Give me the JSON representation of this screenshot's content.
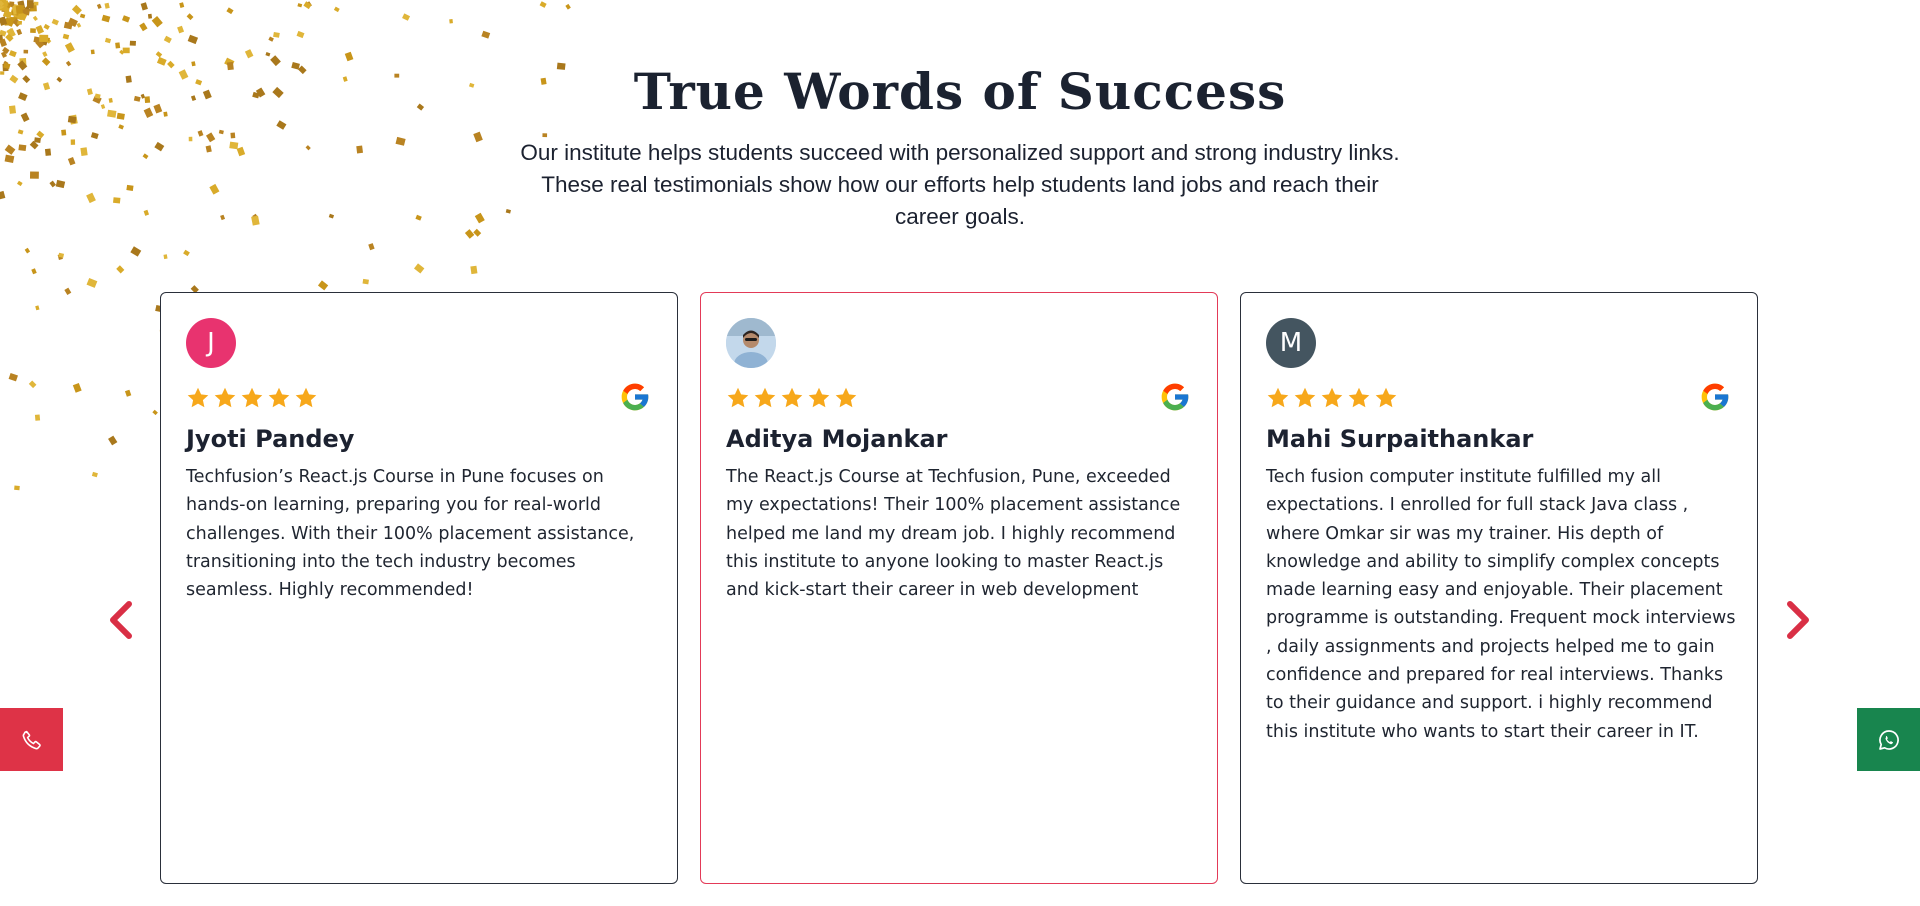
{
  "section": {
    "title": "True Words of Success",
    "subtitle": "Our institute helps students succeed with personalized support and strong industry links. These real testimonials show how our efforts help students land jobs and reach their career goals."
  },
  "testimonials": [
    {
      "name": "Jyoti Pandey",
      "avatar_letter": "J",
      "avatar_color": "#e8336f",
      "rating": 5,
      "source_icon": "google-icon",
      "text": "Techfusion’s React.js Course in Pune focuses on hands-on learning, preparing you for real-world challenges. With their 100% placement assistance, transitioning into the tech industry becomes seamless. Highly recommended!"
    },
    {
      "name": "Aditya Mojankar",
      "avatar_letter": "",
      "avatar_color": "#b9d3ea",
      "rating": 5,
      "source_icon": "google-icon",
      "text": "The React.js Course at Techfusion, Pune, exceeded my expectations! Their 100% placement assistance helped me land my dream job. I highly recommend this institute to anyone looking to master React.js and kick-start their career in web development"
    },
    {
      "name": "Mahi Surpaithankar",
      "avatar_letter": "M",
      "avatar_color": "#445560",
      "rating": 5,
      "source_icon": "google-icon",
      "text": "Tech fusion computer institute fulfilled my all expectations. I enrolled for full stack Java class , where Omkar sir was my trainer. His depth of knowledge and ability to simplify complex concepts made learning easy and enjoyable. Their placement programme is outstanding. Frequent mock interviews , daily assignments and projects helped me to gain confidence and prepared for real interviews. Thanks to their guidance and support. i highly recommend this institute who wants to start their career in IT."
    }
  ],
  "navigation": {
    "prev_icon": "chevron-left-icon",
    "next_icon": "chevron-right-icon"
  },
  "floating_actions": {
    "call_icon": "phone-icon",
    "whatsapp_icon": "whatsapp-icon"
  },
  "colors": {
    "accent": "#e33a58",
    "star": "#f7a81b",
    "call_button": "#de3347",
    "whatsapp_button": "#18854e",
    "confetti": "#d0a021"
  }
}
